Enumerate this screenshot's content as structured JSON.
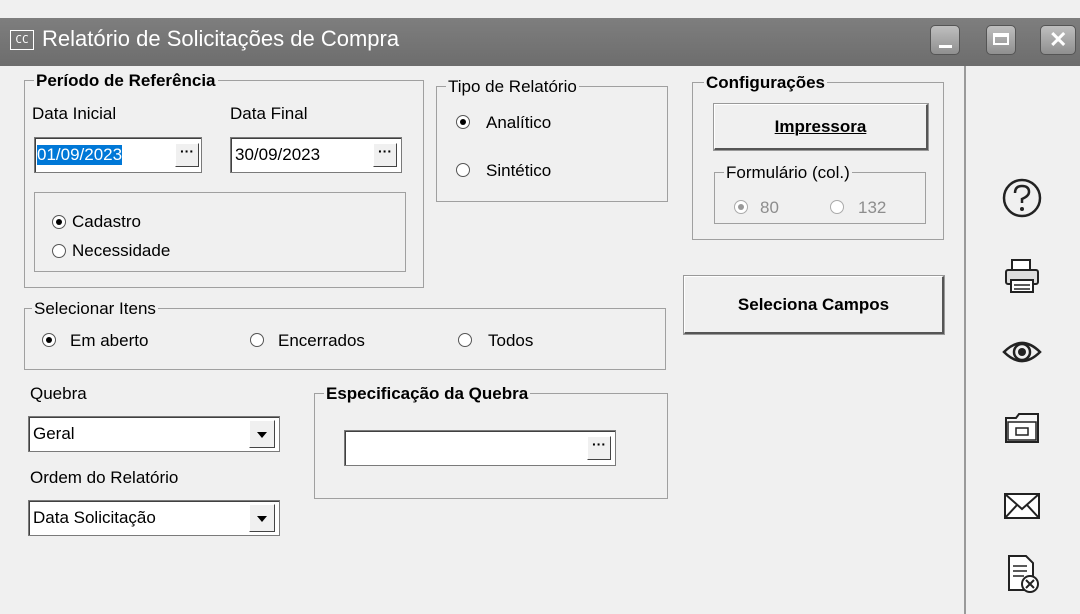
{
  "window": {
    "app_icon": "CC",
    "title": "Relatório de Solicitações de Compra"
  },
  "periodo": {
    "legend": "Período de Referência",
    "data_inicial_label": "Data Inicial",
    "data_inicial_value": "01/09/2023",
    "data_final_label": "Data Final",
    "data_final_value": "30/09/2023",
    "ellipsis": "···",
    "options": [
      {
        "label": "Cadastro",
        "checked": true
      },
      {
        "label": "Necessidade",
        "checked": false
      }
    ]
  },
  "tipo": {
    "legend": "Tipo de Relatório",
    "options": [
      {
        "label": "Analítico",
        "checked": true
      },
      {
        "label": "Sintético",
        "checked": false
      }
    ]
  },
  "configuracoes": {
    "legend": "Configurações",
    "impressora_label": "Impressora",
    "formulario_legend": "Formulário (col.)",
    "options": [
      {
        "label": "80",
        "checked": true
      },
      {
        "label": "132",
        "checked": false
      }
    ]
  },
  "seleciona_campos_label": "Seleciona Campos",
  "selecionar_itens": {
    "legend": "Selecionar Itens",
    "options": [
      {
        "label": "Em aberto",
        "checked": true
      },
      {
        "label": "Encerrados",
        "checked": false
      },
      {
        "label": "Todos",
        "checked": false
      }
    ]
  },
  "quebra": {
    "label": "Quebra",
    "value": "Geral"
  },
  "ordem": {
    "label": "Ordem do Relatório",
    "value": "Data Solicitação"
  },
  "especificacao": {
    "legend": "Especificação da Quebra",
    "value": "",
    "ellipsis": "···"
  },
  "sidebar": {
    "icons": [
      "help-icon",
      "printer-icon",
      "preview-eye-icon",
      "export-folder-icon",
      "email-icon",
      "cancel-report-icon"
    ]
  }
}
